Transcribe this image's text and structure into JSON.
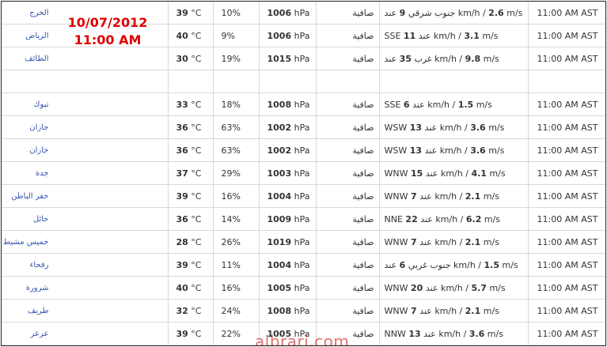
{
  "stamp": {
    "date": "10/07/2012",
    "time": "11:00 AM"
  },
  "watermark": "albrari.com",
  "rows": [
    {
      "city": "الخرج",
      "temp": "39",
      "unit": " °C",
      "humidity": "10%",
      "pressure": "1006",
      "punit": " hPa",
      "condition": "صافية",
      "wind_dir": "جنوب شرقي",
      "wind_kmh": "9",
      "wind_ms": "2.6",
      "time": "11:00 AM AST"
    },
    {
      "city": "الرياض",
      "temp": "40",
      "unit": " °C",
      "humidity": "9%",
      "pressure": "1006",
      "punit": " hPa",
      "condition": "صافية",
      "wind_dir": "SSE",
      "wind_kmh": "11",
      "wind_ms": "3.1",
      "time": "11:00 AM AST"
    },
    {
      "city": "الطائف",
      "temp": "30",
      "unit": " °C",
      "humidity": "19%",
      "pressure": "1015",
      "punit": " hPa",
      "condition": "صافية",
      "wind_dir": "غرب",
      "wind_kmh": "35",
      "wind_ms": "9.8",
      "time": "11:00 AM AST"
    },
    {
      "separator": true
    },
    {
      "city": "تبوك",
      "temp": "33",
      "unit": " °C",
      "humidity": "18%",
      "pressure": "1008",
      "punit": " hPa",
      "condition": "صافية",
      "wind_dir": "SSE",
      "wind_kmh": "6",
      "wind_ms": "1.5",
      "time": "11:00 AM AST"
    },
    {
      "city": "جازان",
      "temp": "36",
      "unit": " °C",
      "humidity": "63%",
      "pressure": "1002",
      "punit": " hPa",
      "condition": "صافية",
      "wind_dir": "WSW",
      "wind_kmh": "13",
      "wind_ms": "3.6",
      "time": "11:00 AM AST"
    },
    {
      "city": "جازان",
      "temp": "36",
      "unit": " °C",
      "humidity": "63%",
      "pressure": "1002",
      "punit": " hPa",
      "condition": "صافية",
      "wind_dir": "WSW",
      "wind_kmh": "13",
      "wind_ms": "3.6",
      "time": "11:00 AM AST"
    },
    {
      "city": "جدة",
      "temp": "37",
      "unit": " °C",
      "humidity": "29%",
      "pressure": "1003",
      "punit": " hPa",
      "condition": "صافية",
      "wind_dir": "WNW",
      "wind_kmh": "15",
      "wind_ms": "4.1",
      "time": "11:00 AM AST"
    },
    {
      "city": "حفر الباطن",
      "temp": "39",
      "unit": " °C",
      "humidity": "16%",
      "pressure": "1004",
      "punit": " hPa",
      "condition": "صافية",
      "wind_dir": "WNW",
      "wind_kmh": "7",
      "wind_ms": "2.1",
      "time": "11:00 AM AST"
    },
    {
      "city": "حائل",
      "temp": "36",
      "unit": " °C",
      "humidity": "14%",
      "pressure": "1009",
      "punit": " hPa",
      "condition": "صافية",
      "wind_dir": "NNE",
      "wind_kmh": "22",
      "wind_ms": "6.2",
      "time": "11:00 AM AST"
    },
    {
      "city": "خميس مشيط",
      "temp": "28",
      "unit": " °C",
      "humidity": "26%",
      "pressure": "1019",
      "punit": " hPa",
      "condition": "صافية",
      "wind_dir": "WNW",
      "wind_kmh": "7",
      "wind_ms": "2.1",
      "time": "11:00 AM AST"
    },
    {
      "city": "رفحاء",
      "temp": "39",
      "unit": " °C",
      "humidity": "11%",
      "pressure": "1004",
      "punit": " hPa",
      "condition": "صافية",
      "wind_dir": "جنوب غربي",
      "wind_kmh": "6",
      "wind_ms": "1.5",
      "time": "11:00 AM AST"
    },
    {
      "city": "شرورة",
      "temp": "40",
      "unit": " °C",
      "humidity": "16%",
      "pressure": "1005",
      "punit": " hPa",
      "condition": "صافية",
      "wind_dir": "WNW",
      "wind_kmh": "20",
      "wind_ms": "5.7",
      "time": "11:00 AM AST"
    },
    {
      "city": "طريف",
      "temp": "32",
      "unit": " °C",
      "humidity": "24%",
      "pressure": "1008",
      "punit": " hPa",
      "condition": "صافية",
      "wind_dir": "WNW",
      "wind_kmh": "7",
      "wind_ms": "2.1",
      "time": "11:00 AM AST"
    },
    {
      "city": "عرعر",
      "temp": "39",
      "unit": " °C",
      "humidity": "22%",
      "pressure": "1005",
      "punit": " hPa",
      "condition": "صافية",
      "wind_dir": "NNW",
      "wind_kmh": "13",
      "wind_ms": "3.6",
      "time": "11:00 AM AST"
    }
  ],
  "labels": {
    "speed_word": "عند",
    "kmh": "km/h",
    "ms": "m/s"
  }
}
